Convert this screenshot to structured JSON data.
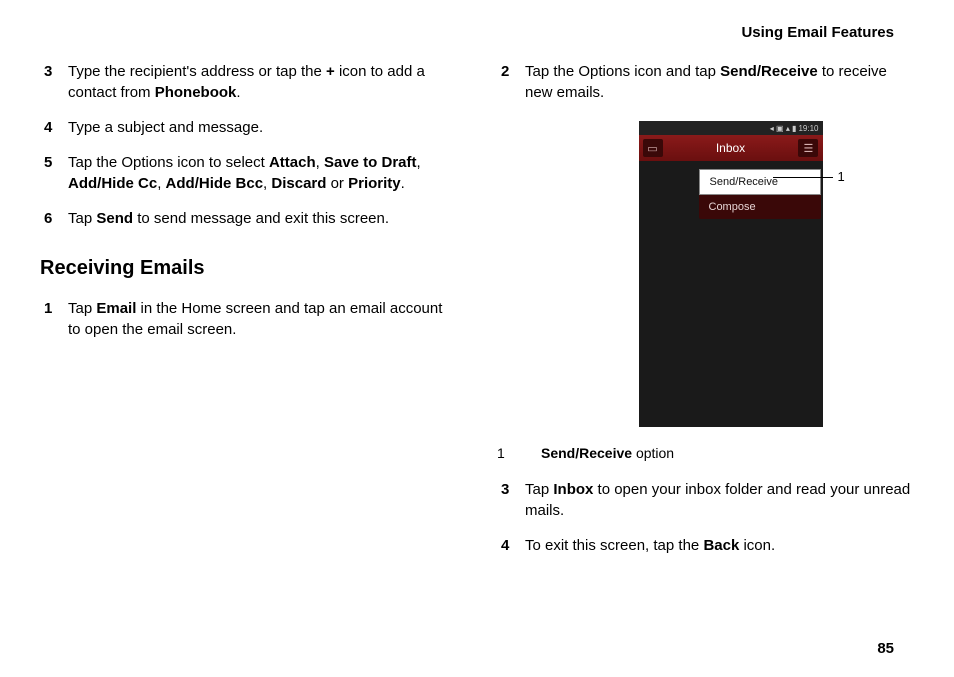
{
  "header": {
    "title": "Using Email Features"
  },
  "pageNumber": "85",
  "left": {
    "steps": [
      {
        "num": "3",
        "runs": [
          {
            "t": "Type the recipient's address or tap the "
          },
          {
            "t": "+",
            "b": true
          },
          {
            "t": " icon to add a contact from "
          },
          {
            "t": "Phonebook",
            "b": true
          },
          {
            "t": "."
          }
        ]
      },
      {
        "num": "4",
        "runs": [
          {
            "t": "Type a subject and message."
          }
        ]
      },
      {
        "num": "5",
        "runs": [
          {
            "t": "Tap the Options icon to select "
          },
          {
            "t": "Attach",
            "b": true
          },
          {
            "t": ", "
          },
          {
            "t": "Save to Draft",
            "b": true
          },
          {
            "t": ", "
          },
          {
            "t": "Add/Hide Cc",
            "b": true
          },
          {
            "t": ", "
          },
          {
            "t": "Add/Hide Bcc",
            "b": true
          },
          {
            "t": ", "
          },
          {
            "t": "Discard",
            "b": true
          },
          {
            "t": " or "
          },
          {
            "t": "Priority",
            "b": true
          },
          {
            "t": "."
          }
        ]
      },
      {
        "num": "6",
        "runs": [
          {
            "t": "Tap "
          },
          {
            "t": "Send",
            "b": true
          },
          {
            "t": " to send message and exit this screen."
          }
        ]
      }
    ],
    "sectionTitle": "Receiving Emails",
    "steps2": [
      {
        "num": "1",
        "runs": [
          {
            "t": "Tap "
          },
          {
            "t": "Email",
            "b": true
          },
          {
            "t": " in the Home screen and tap an email account to open the email screen."
          }
        ]
      }
    ]
  },
  "right": {
    "stepsA": [
      {
        "num": "2",
        "runs": [
          {
            "t": "Tap the Options icon and tap "
          },
          {
            "t": "Send/Receive",
            "b": true
          },
          {
            "t": " to receive new emails."
          }
        ]
      }
    ],
    "phone": {
      "status": {
        "time": "19:10",
        "iconsText": "◂ ▣ ▴ ▮"
      },
      "headerBar": {
        "title": "Inbox"
      },
      "menu": {
        "item1": "Send/Receive",
        "item2": "Compose"
      },
      "calloutNum": "1"
    },
    "legend": {
      "num": "1",
      "runs": [
        {
          "t": "Send/Receive",
          "b": true
        },
        {
          "t": " option"
        }
      ]
    },
    "stepsB": [
      {
        "num": "3",
        "runs": [
          {
            "t": "Tap "
          },
          {
            "t": "Inbox",
            "b": true
          },
          {
            "t": " to open your inbox folder and read your unread mails."
          }
        ]
      },
      {
        "num": "4",
        "runs": [
          {
            "t": "To exit this screen, tap the "
          },
          {
            "t": "Back",
            "b": true
          },
          {
            "t": " icon."
          }
        ]
      }
    ]
  }
}
